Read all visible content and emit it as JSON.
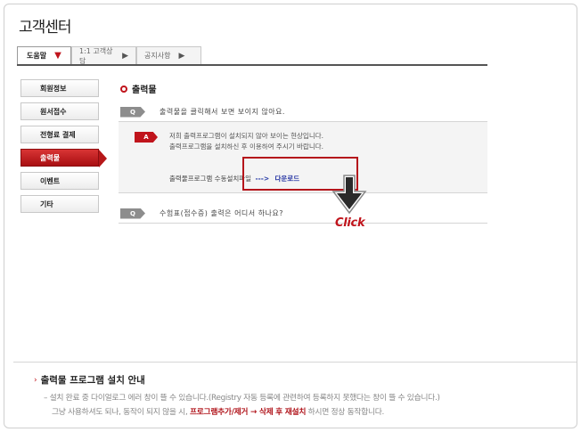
{
  "page": {
    "title": "고객센터"
  },
  "tabs": [
    {
      "label": "도움말",
      "active": true
    },
    {
      "label": "1:1 고객상담",
      "active": false
    },
    {
      "label": "공지사항",
      "active": false
    }
  ],
  "sidebar": {
    "items": [
      {
        "label": "회원정보",
        "active": false
      },
      {
        "label": "원서접수",
        "active": false
      },
      {
        "label": "전형료 결제",
        "active": false
      },
      {
        "label": "출력물",
        "active": true
      },
      {
        "label": "이벤트",
        "active": false
      },
      {
        "label": "기타",
        "active": false
      }
    ]
  },
  "main": {
    "section_title": "출력물",
    "faq": [
      {
        "q_badge": "Q",
        "question": "출력물을 클릭해서 보면 보이지 않아요.",
        "a_badge": "A",
        "answer_lines": [
          "저희 출력프로그램이 설치되지 않아 보이는 현상입니다.",
          "출력프로그램을 설치하신 후 이용하여 주시기 바랍니다."
        ],
        "download_text": "출력물프로그램 수동설치파일",
        "download_arrow": "--->",
        "download_link": "다운로드"
      },
      {
        "q_badge": "Q",
        "question": "수험표(접수증) 출력은 어디서 하나요?"
      }
    ],
    "click_label": "Click"
  },
  "notice": {
    "bullet": "›",
    "title": "출력물 프로그램 설치 안내",
    "line1": "– 설치 완료 중 다이얼로그 에러 창이 뜰 수 있습니다.(Registry 자동 등록에 관련하여 등록하지 못했다는 창이 뜰 수 있습니다.)",
    "line2_pre": "그냥 사용하셔도 되나, 동작이 되지 않을 시,",
    "line2_em": "프로그램추가/제거 → 삭제 후 재설치",
    "line2_post": "하시면 정상 동작합니다."
  },
  "colors": {
    "accent_red": "#c0141c",
    "link_blue": "#1f2ea0"
  }
}
